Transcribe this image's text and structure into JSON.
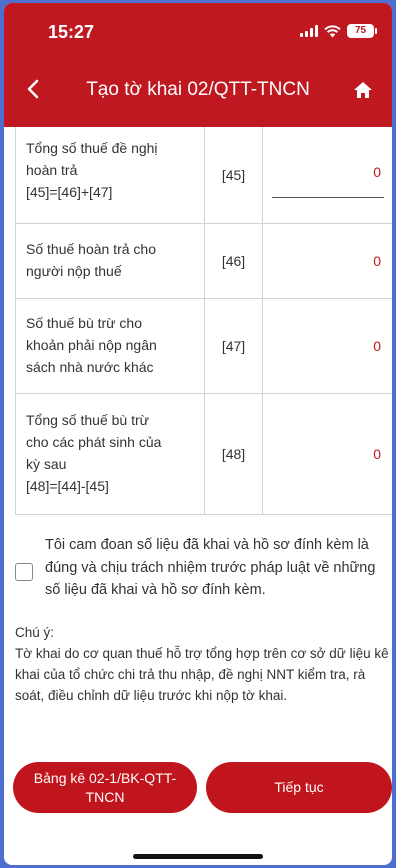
{
  "status_bar": {
    "time": "15:27",
    "battery": "75"
  },
  "header": {
    "title": "Tạo tờ khai 02/QTT-TNCN",
    "back_icon": "chevron-left-icon",
    "home_icon": "home-icon"
  },
  "table": {
    "rows": [
      {
        "label": "Tổng số thuế đề nghị\nhoàn trả\n[45]=[46]+[47]",
        "code": "[45]",
        "value": "0"
      },
      {
        "label": "Số thuế hoàn trả cho\nngười nộp thuế",
        "code": "[46]",
        "value": "0"
      },
      {
        "label": "Số thuế bù trừ cho\nkhoản phải nộp ngân\nsách nhà nước khác",
        "code": "[47]",
        "value": "0"
      },
      {
        "label": "Tổng số thuế bù trừ\ncho các phát sinh của\nkỳ sau\n[48]=[44]-[45]",
        "code": "[48]",
        "value": "0"
      }
    ]
  },
  "declaration": {
    "text": "Tôi cam đoan số liệu đã khai và hồ sơ đính kèm là đúng và chịu trách nhiệm trước pháp luật về những số liệu đã khai và hồ sơ đính kèm.",
    "checked": false
  },
  "note": {
    "heading": "Chú ý:",
    "body": "Tờ khai do cơ quan thuế hỗ trợ tổng hợp trên cơ sở dữ liệu kê khai của tổ chức chi trả thu nhập, đề nghị NNT kiểm tra, rà soát, điều chỉnh dữ liệu trước khi nộp tờ khai."
  },
  "buttons": {
    "left": "Bảng kê 02-1/BK-QTT-TNCN",
    "right": "Tiếp tục"
  },
  "colors": {
    "brand": "#bf1820",
    "value_text": "#c0151d"
  }
}
